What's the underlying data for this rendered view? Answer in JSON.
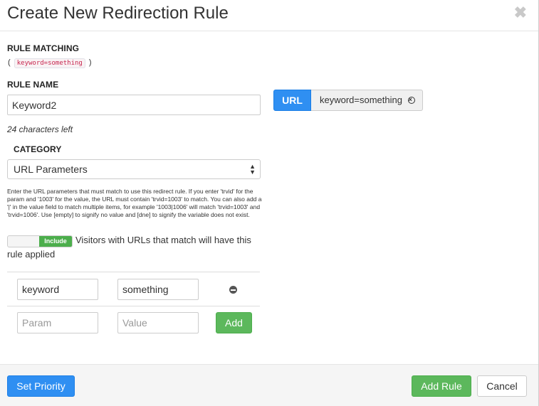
{
  "modal": {
    "title": "Create New Redirection Rule",
    "close_icon": "close-icon"
  },
  "rule_matching": {
    "heading": "RULE MATCHING",
    "open_paren": "(",
    "code": "keyword=something",
    "close_paren": ")"
  },
  "rule_name": {
    "heading": "RULE NAME",
    "value": "Keyword2",
    "chars_left": "24 characters left"
  },
  "category": {
    "heading": "CATEGORY",
    "selected": "URL Parameters"
  },
  "help_text": "Enter the URL parameters that must match to use this redirect rule. If you enter 'trvid' for the param and '1003' for the value, the URL must contain 'trvid=1003' to match. You can also add a '|' in the value field to match multiple items, for example '1003|1006' will match 'trvid=1003' and 'trvid=1006'. Use [empty] to signify no value and [dne] to signify the variable does not exist.",
  "toggle": {
    "label": "Include",
    "description": "Visitors with URLs that match will have this rule applied"
  },
  "params": {
    "rows": [
      {
        "param": "keyword",
        "value": "something"
      }
    ],
    "param_placeholder": "Param",
    "value_placeholder": "Value",
    "add_label": "Add"
  },
  "url_tag": {
    "label": "URL",
    "value": "keyword=something"
  },
  "footer": {
    "set_priority_label": "Set Priority",
    "add_rule_label": "Add Rule",
    "cancel_label": "Cancel"
  },
  "colors": {
    "primary": "#2f8ff2",
    "success": "#5cb85c",
    "code_text": "#c7254e"
  }
}
